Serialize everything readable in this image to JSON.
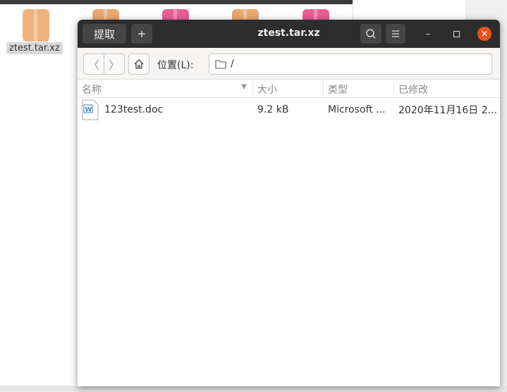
{
  "desktop": {
    "selected_label": "ztest.tar.xz",
    "colors": {
      "archive": "#f0b27f",
      "pink": "#ea5e95"
    }
  },
  "window": {
    "title": "ztest.tar.xz",
    "extract_label": "提取",
    "add_label": "+",
    "location_label": "位置(L):",
    "location_value": "/",
    "columns": [
      "名称",
      "大小",
      "类型",
      "已修改"
    ],
    "files": [
      {
        "name": "123test.doc",
        "size": "9.2 kB",
        "type": "Microsoft ...",
        "modified": "2020年11月16日 2..."
      }
    ]
  },
  "accent": "#e95420"
}
